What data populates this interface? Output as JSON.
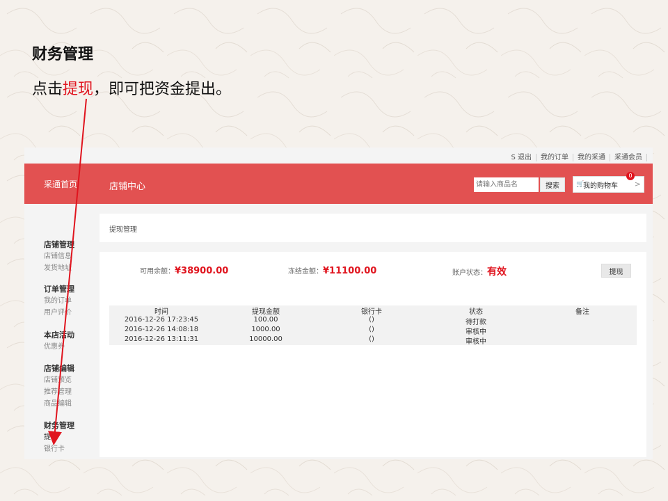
{
  "slide": {
    "title": "财务管理",
    "subtitle_pre": "点击",
    "subtitle_highlight": "提现",
    "subtitle_post": "，即可把资金提出。"
  },
  "topbar": {
    "links": [
      "S  退出",
      "我的订单",
      "我的采通",
      "采通会员"
    ]
  },
  "header": {
    "logo": "采通首页",
    "center_title": "店铺中心",
    "search_placeholder": "请输入商品名",
    "search_button": "搜索",
    "cart_label": "我的购物车",
    "cart_count": "0",
    "cart_chevron": ">",
    "cart_icon": "cart-icon"
  },
  "sidebar": {
    "groups": [
      {
        "title": "店铺管理",
        "items": [
          "店铺信息",
          "发货地址"
        ]
      },
      {
        "title": "订单管理",
        "items": [
          "我的订单",
          "用户评价"
        ]
      },
      {
        "title": "本店活动",
        "items": [
          "优惠券"
        ]
      },
      {
        "title": "店铺编辑",
        "items": [
          "店铺预览",
          "推荐管理",
          "商品编辑"
        ]
      },
      {
        "title": "财务管理",
        "items": [
          "提现",
          "银行卡"
        ]
      }
    ]
  },
  "breadcrumb": "提现管理",
  "stats": {
    "available_label": "可用余额：",
    "available_value": "¥38900.00",
    "frozen_label": "冻结金额：",
    "frozen_value": "¥11100.00",
    "status_label": "账户状态：",
    "status_value": "有效",
    "withdraw_button": "提现"
  },
  "table": {
    "headers": [
      "时间",
      "提现金额",
      "银行卡",
      "状态",
      "备注"
    ],
    "rows": [
      [
        "2016-12-26 17:23:45",
        "100.00",
        "()",
        "待打款",
        ""
      ],
      [
        "2016-12-26 14:08:18",
        "1000.00",
        "()",
        "审核中",
        ""
      ],
      [
        "2016-12-26 13:11:31",
        "10000.00",
        "()",
        "审核中",
        ""
      ]
    ]
  },
  "colors": {
    "header_red": "#e25151",
    "highlight_red": "#e0141e"
  }
}
